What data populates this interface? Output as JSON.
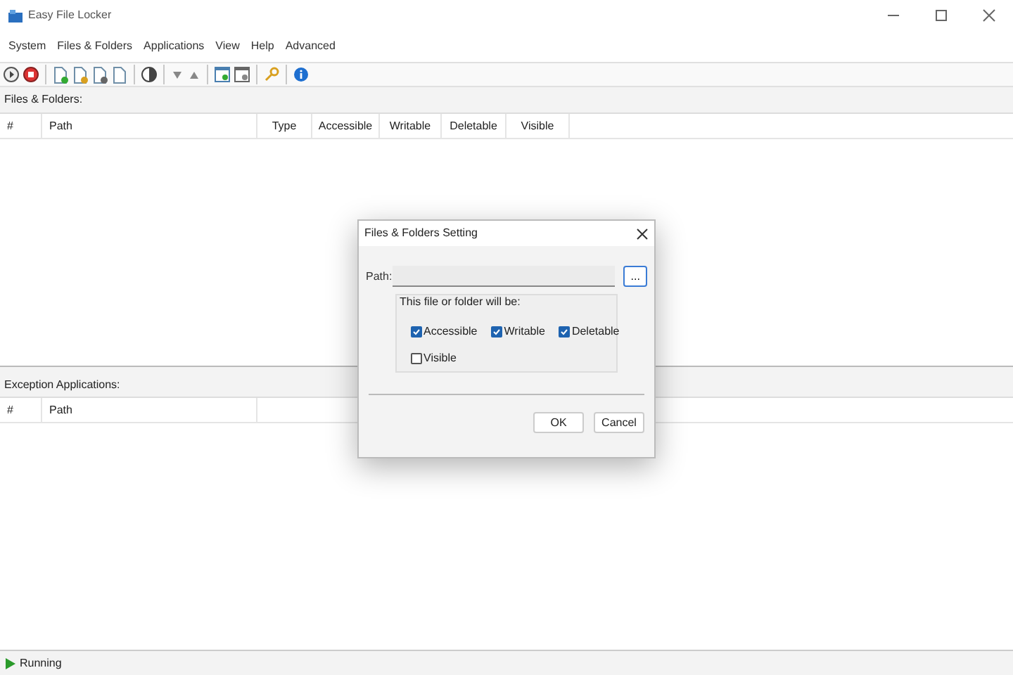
{
  "window": {
    "title": "Easy File Locker"
  },
  "menu": [
    "System",
    "Files & Folders",
    "Applications",
    "View",
    "Help",
    "Advanced"
  ],
  "files_panel": {
    "label": "Files & Folders:",
    "columns": [
      "#",
      "Path",
      "Type",
      "Accessible",
      "Writable",
      "Deletable",
      "Visible"
    ]
  },
  "exceptions_panel": {
    "label": "Exception Applications:",
    "columns": [
      "#",
      "Path"
    ]
  },
  "dialog": {
    "title": "Files & Folders Setting",
    "path_label": "Path:",
    "browse_button": "...",
    "group_label": "This file or folder will be:",
    "options": [
      {
        "label": "Accessible",
        "checked": true
      },
      {
        "label": "Writable",
        "checked": true
      },
      {
        "label": "Deletable",
        "checked": true
      },
      {
        "label": "Visible",
        "checked": false
      }
    ],
    "buttons": [
      "OK",
      "Cancel"
    ]
  },
  "status_bar": {
    "text": "Running"
  }
}
